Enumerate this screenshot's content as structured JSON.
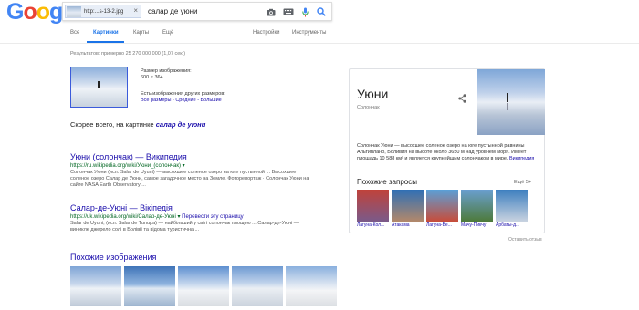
{
  "logo": {
    "letters": [
      "G",
      "o",
      "o",
      "g",
      "l",
      "e"
    ],
    "colors": [
      "#4285F4",
      "#EA4335",
      "#FBBC05",
      "#4285F4",
      "#34A853",
      "#EA4335"
    ]
  },
  "search": {
    "chip_filename": "http:...s-13-2.jpg",
    "chip_close": "×",
    "query": "салар де уюни",
    "icons": [
      "camera-icon",
      "keyboard-icon",
      "microphone-icon",
      "search-icon"
    ]
  },
  "tabs": {
    "items": [
      "Все",
      "Картинки",
      "Карты",
      "Ещё"
    ],
    "active": "Картинки",
    "right": [
      "Настройки",
      "Инструменты"
    ]
  },
  "stats": "Результатов: примерно 25 270 000 000 (1,07 сек.)",
  "query_image": {
    "size_label": "Размер изображения:",
    "size_value": "600 × 364",
    "other_sizes_label": "Есть изображения других размеров:",
    "other_sizes_links": "Все размеры - Средние - Большие"
  },
  "best_guess": {
    "prefix": "Скорее всего, на картинке",
    "value": "салар де уюни"
  },
  "results": [
    {
      "title": "Уюни (солончак) — Википедия",
      "url": "https://ru.wikipedia.org/wiki/Уюни_(солончак)",
      "translate": "",
      "snippet_1": "Солончак Уюни (исп. Salar de Uyuni) — высохшее соленое озеро на юге пустынной ... Высохшее",
      "snippet_2": "соленое озеро Салар де Уюни, самое загадочное место на Земле. Фоторепортаж · Солончак Уюни на",
      "snippet_3": "сайте NASA Earth Observatory ..."
    },
    {
      "title": "Салар-де-Уюні — Вікіпедія",
      "url": "https://uk.wikipedia.org/wiki/Салар-де-Уюні",
      "translate": "Перевести эту страницу",
      "snippet_1": "Salar de Uyuni, (исп. Salar de Tunupa) — найбільший у світі солончак площею ... Салар-де-Уюні —",
      "snippet_2": "виникле джерело солі в Болівії та відома туристична ...",
      "snippet_3": ""
    }
  ],
  "similar_images": {
    "title": "Похожие изображения"
  },
  "knowledge_panel": {
    "title": "Уюни",
    "subtitle": "Солончак",
    "description": "Солончак Уюни — высохшее соленое озеро на юге пустынной равнины Альтиплано, Боливия на высоте около 3650 м над уровнем моря. Имеет площадь 10 588 км² и является крупнейшим солончаком в мире.",
    "source": "Википедия",
    "related_title": "Похожие запросы",
    "more": "Ещё 5+",
    "related": [
      {
        "label": "Лагуна-Кол...",
        "color_top": "#c0423a",
        "color_bottom": "#7a5a8a"
      },
      {
        "label": "Атакама",
        "color_top": "#2f6fb5",
        "color_bottom": "#b3886a"
      },
      {
        "label": "Лагуна-Ве...",
        "color_top": "#5aa0d8",
        "color_bottom": "#c84c3a"
      },
      {
        "label": "Мачу-Пикчу",
        "color_top": "#6a9fd0",
        "color_bottom": "#4d7a3a"
      },
      {
        "label": "Арбаты-д...",
        "color_top": "#3d7fbf",
        "color_bottom": "#c9d3e0"
      }
    ]
  },
  "feedback": "Оставить отзыв"
}
